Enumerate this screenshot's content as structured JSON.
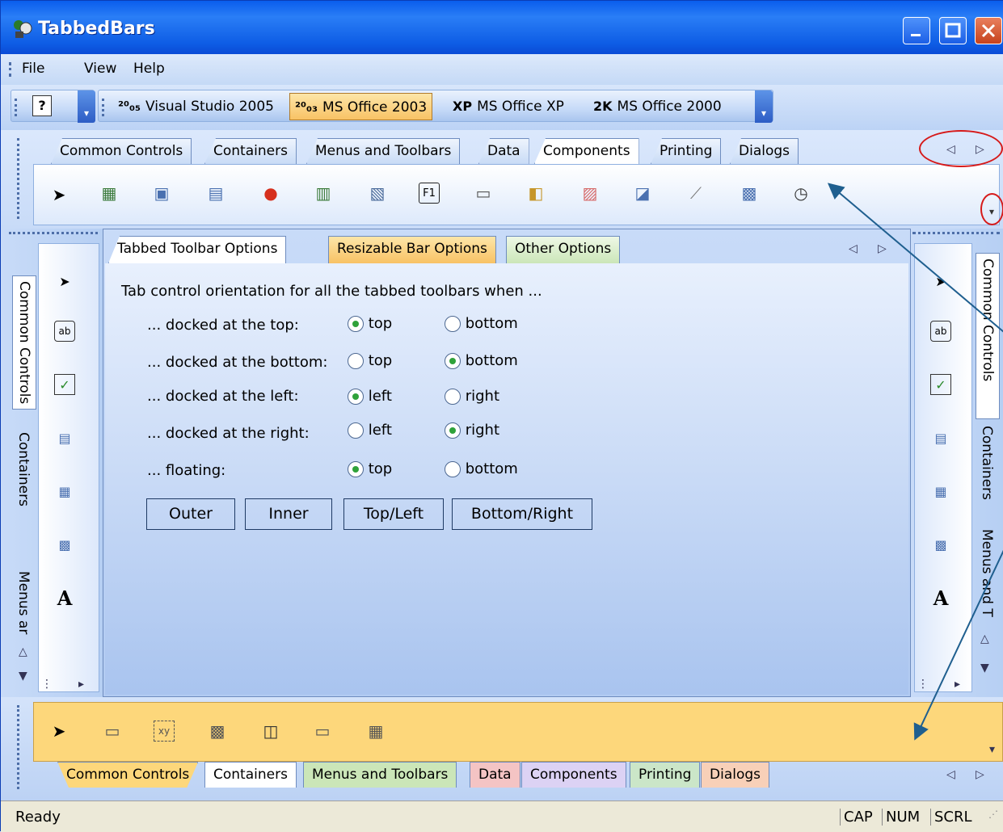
{
  "title": "TabbedBars",
  "menu": [
    "File",
    "View",
    "Help"
  ],
  "theme_buttons": [
    {
      "badge": "20/05",
      "label": "Visual Studio 2005"
    },
    {
      "badge": "20/03",
      "label": "MS Office 2003"
    },
    {
      "badge": "XP",
      "label": "MS Office XP"
    },
    {
      "badge": "2K",
      "label": "MS Office 2000"
    }
  ],
  "top_tabs": [
    "Common Controls",
    "Containers",
    "Menus and Toolbars",
    "Data",
    "Components",
    "Printing",
    "Dialogs"
  ],
  "options_tabs": [
    "Tabbed Toolbar Options",
    "Resizable Bar Options",
    "Other Options"
  ],
  "options": {
    "heading": "Tab control orientation for all the tabbed toolbars when ...",
    "rows": [
      {
        "label": "... docked at the top:",
        "a": "top",
        "b": "bottom",
        "sel": "a"
      },
      {
        "label": "... docked at the bottom:",
        "a": "top",
        "b": "bottom",
        "sel": "b"
      },
      {
        "label": "... docked at the left:",
        "a": "left",
        "b": "right",
        "sel": "a"
      },
      {
        "label": "... docked at the right:",
        "a": "left",
        "b": "right",
        "sel": "b"
      },
      {
        "label": "... floating:",
        "a": "top",
        "b": "bottom",
        "sel": "a"
      }
    ],
    "buttons": [
      "Outer",
      "Inner",
      "Top/Left",
      "Bottom/Right"
    ]
  },
  "left_tabs": [
    "Common Controls",
    "Containers",
    "Menus ar"
  ],
  "right_tabs": [
    "Common Controls",
    "Containers",
    "Menus and T"
  ],
  "bottom_tabs": [
    "Common Controls",
    "Containers",
    "Menus and Toolbars",
    "Data",
    "Components",
    "Printing",
    "Dialogs"
  ],
  "status": {
    "text": "Ready",
    "cap": "CAP",
    "num": "NUM",
    "scrl": "SCRL"
  },
  "colors": {
    "title": "#0a5ded",
    "bottom_band": "#fdd77b",
    "accent_sel": "#f8c265"
  }
}
